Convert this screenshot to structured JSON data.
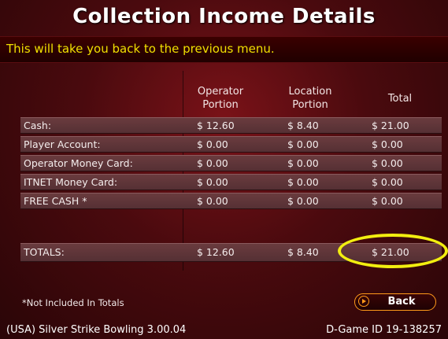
{
  "title": "Collection Income Details",
  "hint": "This will take you back to the previous menu.",
  "columns": {
    "operator": [
      "Operator",
      "Portion"
    ],
    "location": [
      "Location",
      "Portion"
    ],
    "total": "Total"
  },
  "rows": [
    {
      "label": "Cash:",
      "operator": "$ 12.60",
      "location": "$ 8.40",
      "total": "$ 21.00"
    },
    {
      "label": "Player Account:",
      "operator": "$ 0.00",
      "location": "$ 0.00",
      "total": "$ 0.00"
    },
    {
      "label": "Operator Money Card:",
      "operator": "$ 0.00",
      "location": "$ 0.00",
      "total": "$ 0.00"
    },
    {
      "label": "ITNET Money Card:",
      "operator": "$ 0.00",
      "location": "$ 0.00",
      "total": "$ 0.00"
    },
    {
      "label": "FREE CASH *",
      "operator": "$ 0.00",
      "location": "$ 0.00",
      "total": "$ 0.00"
    }
  ],
  "totals": {
    "label": "TOTALS:",
    "operator": "$ 12.60",
    "location": "$ 8.40",
    "total": "$ 21.00"
  },
  "footnote": "*Not Included In Totals",
  "back_button": "Back",
  "status": {
    "game": "(USA) Silver Strike Bowling 3.00.04",
    "game_id": "D-Game ID 19-138257"
  },
  "colors": {
    "accent_yellow": "#f2ee10",
    "button_orange": "#ff9a1a"
  }
}
